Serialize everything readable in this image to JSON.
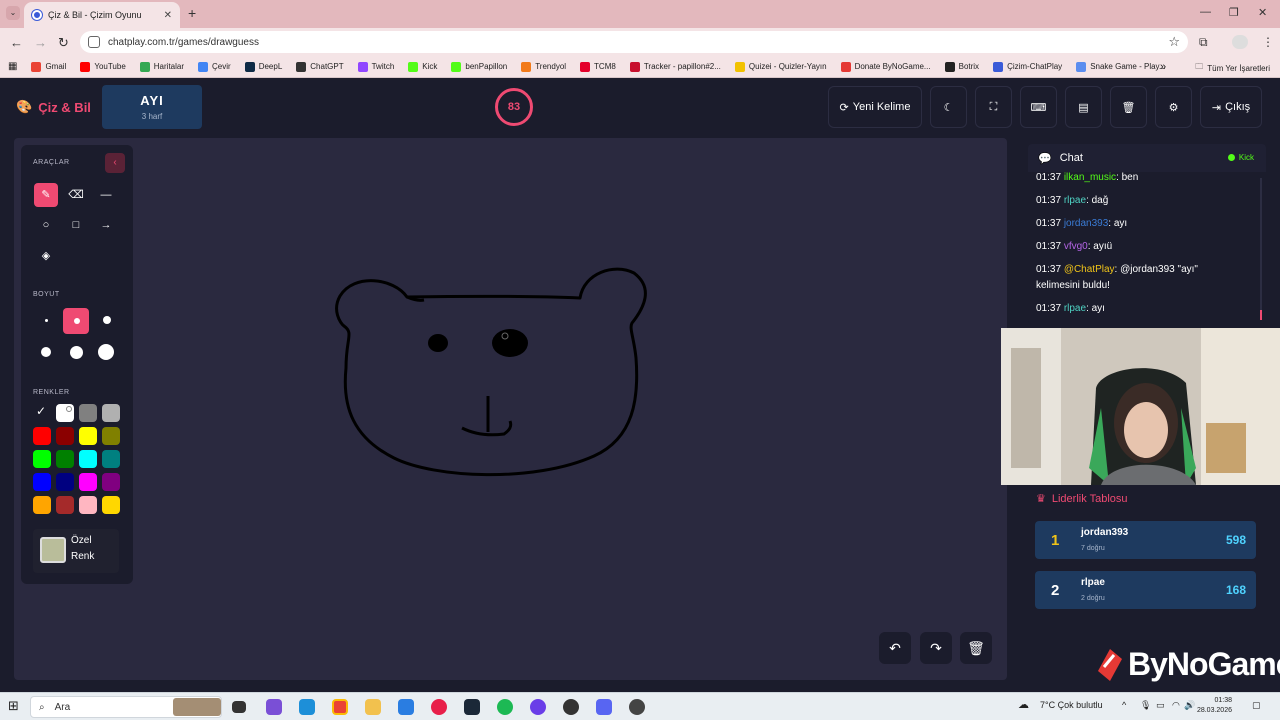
{
  "browser": {
    "tab_title": "Çiz & Bil - Çizim Oyunu",
    "url": "chatplay.com.tr/games/drawguess",
    "bookmarks": [
      {
        "label": "Gmail",
        "color": "#ea4335"
      },
      {
        "label": "YouTube",
        "color": "#ff0000"
      },
      {
        "label": "Haritalar",
        "color": "#34a853"
      },
      {
        "label": "Çevir",
        "color": "#4285f4"
      },
      {
        "label": "DeepL",
        "color": "#0f2b46"
      },
      {
        "label": "ChatGPT",
        "color": "#333333"
      },
      {
        "label": "Twitch",
        "color": "#9146ff"
      },
      {
        "label": "Kick",
        "color": "#53fc18"
      },
      {
        "label": "benPapillon",
        "color": "#53fc18"
      },
      {
        "label": "Trendyol",
        "color": "#f27a1a"
      },
      {
        "label": "TCM8",
        "color": "#e4002b"
      },
      {
        "label": "Tracker - papillon#2...",
        "color": "#c8102e"
      },
      {
        "label": "Quizei - Quizler-Yayın",
        "color": "#f2c200"
      },
      {
        "label": "Donate ByNoGame...",
        "color": "#e53935"
      },
      {
        "label": "Botrix",
        "color": "#222222"
      },
      {
        "label": "Çizim-ChatPlay",
        "color": "#3a5bd8"
      },
      {
        "label": "Snake Game - Play...",
        "color": "#5b8def"
      }
    ],
    "bookmarks_more": "»",
    "all_bookmarks": "Tüm Yer İşaretleri"
  },
  "header": {
    "logo": "Çiz & Bil",
    "word": "AYI",
    "word_hint": "3 harf",
    "timer": "83",
    "buttons": {
      "new_word": "Yeni Kelime",
      "exit": "Çıkış"
    }
  },
  "tools": {
    "section_tools": "ARAÇLAR",
    "section_size": "BOYUT",
    "section_colors": "RENKLER",
    "custom_color_label_1": "Özel",
    "custom_color_label_2": "Renk",
    "custom_color": "#b9bd9a",
    "colors": [
      "#000000",
      "#ffffff",
      "#808080",
      "#b0b0b0",
      "#ff0000",
      "#8b0000",
      "#ffff00",
      "#808000",
      "#00ff00",
      "#008000",
      "#00ffff",
      "#008080",
      "#0000ff",
      "#000080",
      "#ff00ff",
      "#800080",
      "#ffa500",
      "#a52a2a",
      "#ffb6c1",
      "#ffd700"
    ],
    "accent": "#ef4a72"
  },
  "chat": {
    "title": "Chat",
    "source": "Kick",
    "messages": [
      {
        "time": "01:37",
        "user": "ilkan_music",
        "user_color": "#53fc18",
        "text": ": ben"
      },
      {
        "time": "01:37",
        "user": "rlpae",
        "user_color": "#4fd3c4",
        "text": ": dağ"
      },
      {
        "time": "01:37",
        "user": "jordan393",
        "user_color": "#3a7bd5",
        "text": ": ayı"
      },
      {
        "time": "01:37",
        "user": "vfvg0",
        "user_color": "#b565e6",
        "text": ": ayıü"
      },
      {
        "time": "01:37",
        "user": "@ChatPlay",
        "user_color": "#f0c419",
        "text": ": @jordan393 \"ayı\" kelimesini buldu!"
      },
      {
        "time": "01:37",
        "user": "rlpae",
        "user_color": "#4fd3c4",
        "text": ": ayı"
      }
    ]
  },
  "leaderboard": {
    "title": "Liderlik Tablosu",
    "rows": [
      {
        "rank": "1",
        "name": "jordan393",
        "sub": "7 doğru",
        "points": "598"
      },
      {
        "rank": "2",
        "name": "rlpae",
        "sub": "2 doğru",
        "points": "168"
      }
    ]
  },
  "watermark": "ByNoGame",
  "taskbar": {
    "search": "Ara",
    "weather": "7°C  Çok bulutlu",
    "time": "01:38",
    "date": "28.03.2026"
  }
}
